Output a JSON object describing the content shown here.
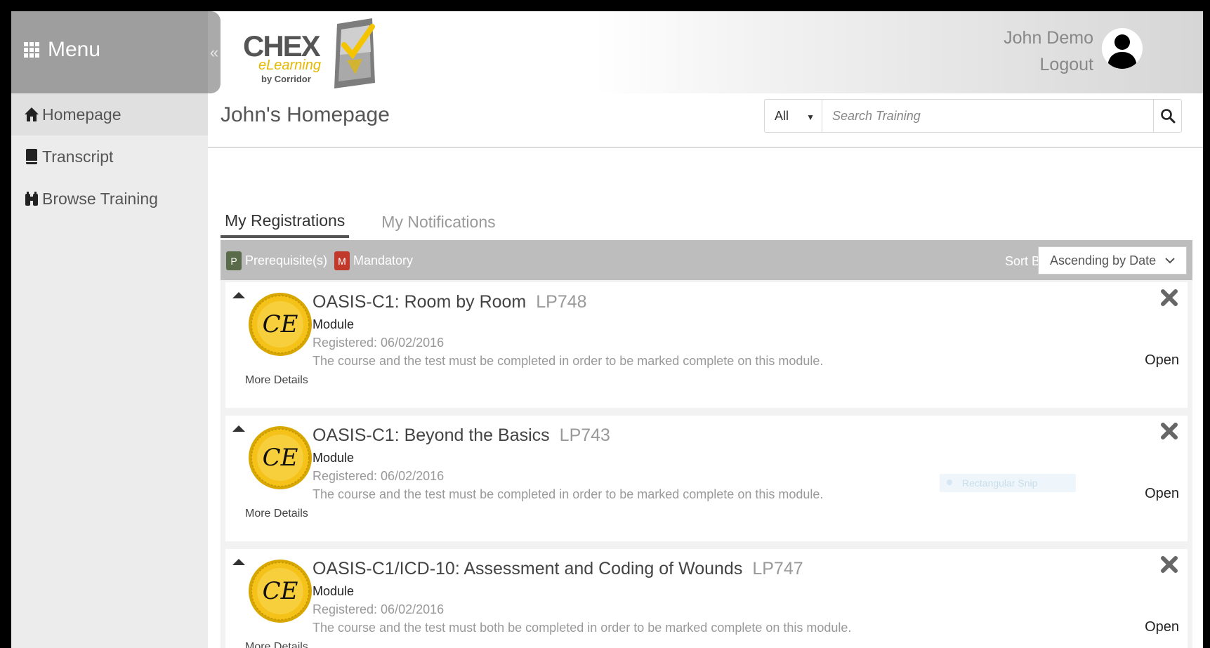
{
  "header": {
    "menu_label": "Menu",
    "collapse_glyph": "«",
    "logo": {
      "word": "CHEX",
      "sub": "eLearning",
      "by": "by Corridor"
    },
    "user_name": "John Demo",
    "logout_label": "Logout"
  },
  "sidebar": {
    "items": [
      {
        "label": "Homepage",
        "icon": "home-icon"
      },
      {
        "label": "Transcript",
        "icon": "book-icon"
      },
      {
        "label": "Browse Training",
        "icon": "binoculars-icon"
      }
    ]
  },
  "main": {
    "page_title": "John's Homepage",
    "search": {
      "scope": "All",
      "placeholder": "Search Training"
    },
    "tabs": [
      {
        "label": "My Registrations"
      },
      {
        "label": "My Notifications"
      }
    ],
    "filter": {
      "legend": [
        {
          "letter": "P",
          "label": "Prerequisite(s)",
          "color": "#5a6b4a"
        },
        {
          "letter": "M",
          "label": "Mandatory",
          "color": "#c0392b"
        }
      ],
      "sort_label": "Sort By",
      "sort_value": "Ascending by Date"
    },
    "registrations": [
      {
        "title": "OASIS-C1: Room by Room",
        "code": "LP748",
        "type": "Module",
        "registered": "Registered: 06/02/2016",
        "description": "The course and the test must be completed in order to be marked complete on this module.",
        "more": "More Details",
        "open": "Open",
        "badge": "CE"
      },
      {
        "title": "OASIS-C1: Beyond the Basics",
        "code": "LP743",
        "type": "Module",
        "registered": "Registered: 06/02/2016",
        "description": "The course and the test must be completed in order to be marked complete on this module.",
        "more": "More Details",
        "open": "Open",
        "badge": "CE"
      },
      {
        "title": "OASIS-C1/ICD-10: Assessment and Coding of Wounds",
        "code": "LP747",
        "type": "Module",
        "registered": "Registered: 06/02/2016",
        "description": "The course and the test must both be completed in order to be marked complete on this module.",
        "more": "More Details",
        "open": "Open",
        "badge": "CE"
      }
    ],
    "snip_overlay": "Rectangular Snip"
  }
}
